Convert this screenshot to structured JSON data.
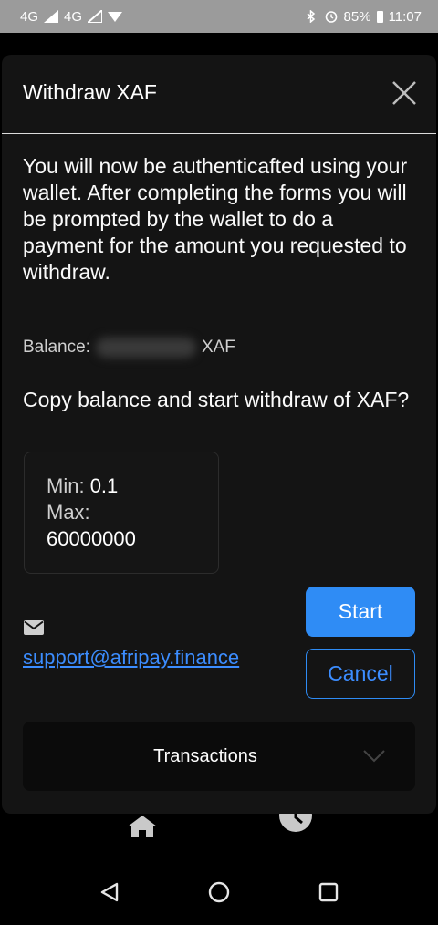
{
  "status_bar": {
    "network1": "4G",
    "network2": "4G",
    "battery": "85%",
    "time": "11:07"
  },
  "dialog": {
    "title": "Withdraw XAF",
    "message": "You will now be authenticafted using your wallet. After completing the forms you will be prompted by the wallet to do a payment for the amount you requested to withdraw.",
    "balance_label": "Balance:",
    "balance_currency": "XAF",
    "question": "Copy balance and start withdraw of XAF?",
    "limits": {
      "min_label": "Min:",
      "min_value": "0.1",
      "max_label": "Max:",
      "max_value": "60000000"
    },
    "support_email": "support@afripay.finance",
    "start_label": "Start",
    "cancel_label": "Cancel",
    "transactions_label": "Transactions"
  },
  "icons": [
    "close-icon",
    "mail-icon",
    "chevron-down-icon",
    "home-icon",
    "clock-icon",
    "back-icon",
    "recents-icon"
  ],
  "colors": {
    "accent": "#2f8cf5",
    "dialog_bg": "#141414",
    "statusbar_bg": "#9b9b9b"
  }
}
